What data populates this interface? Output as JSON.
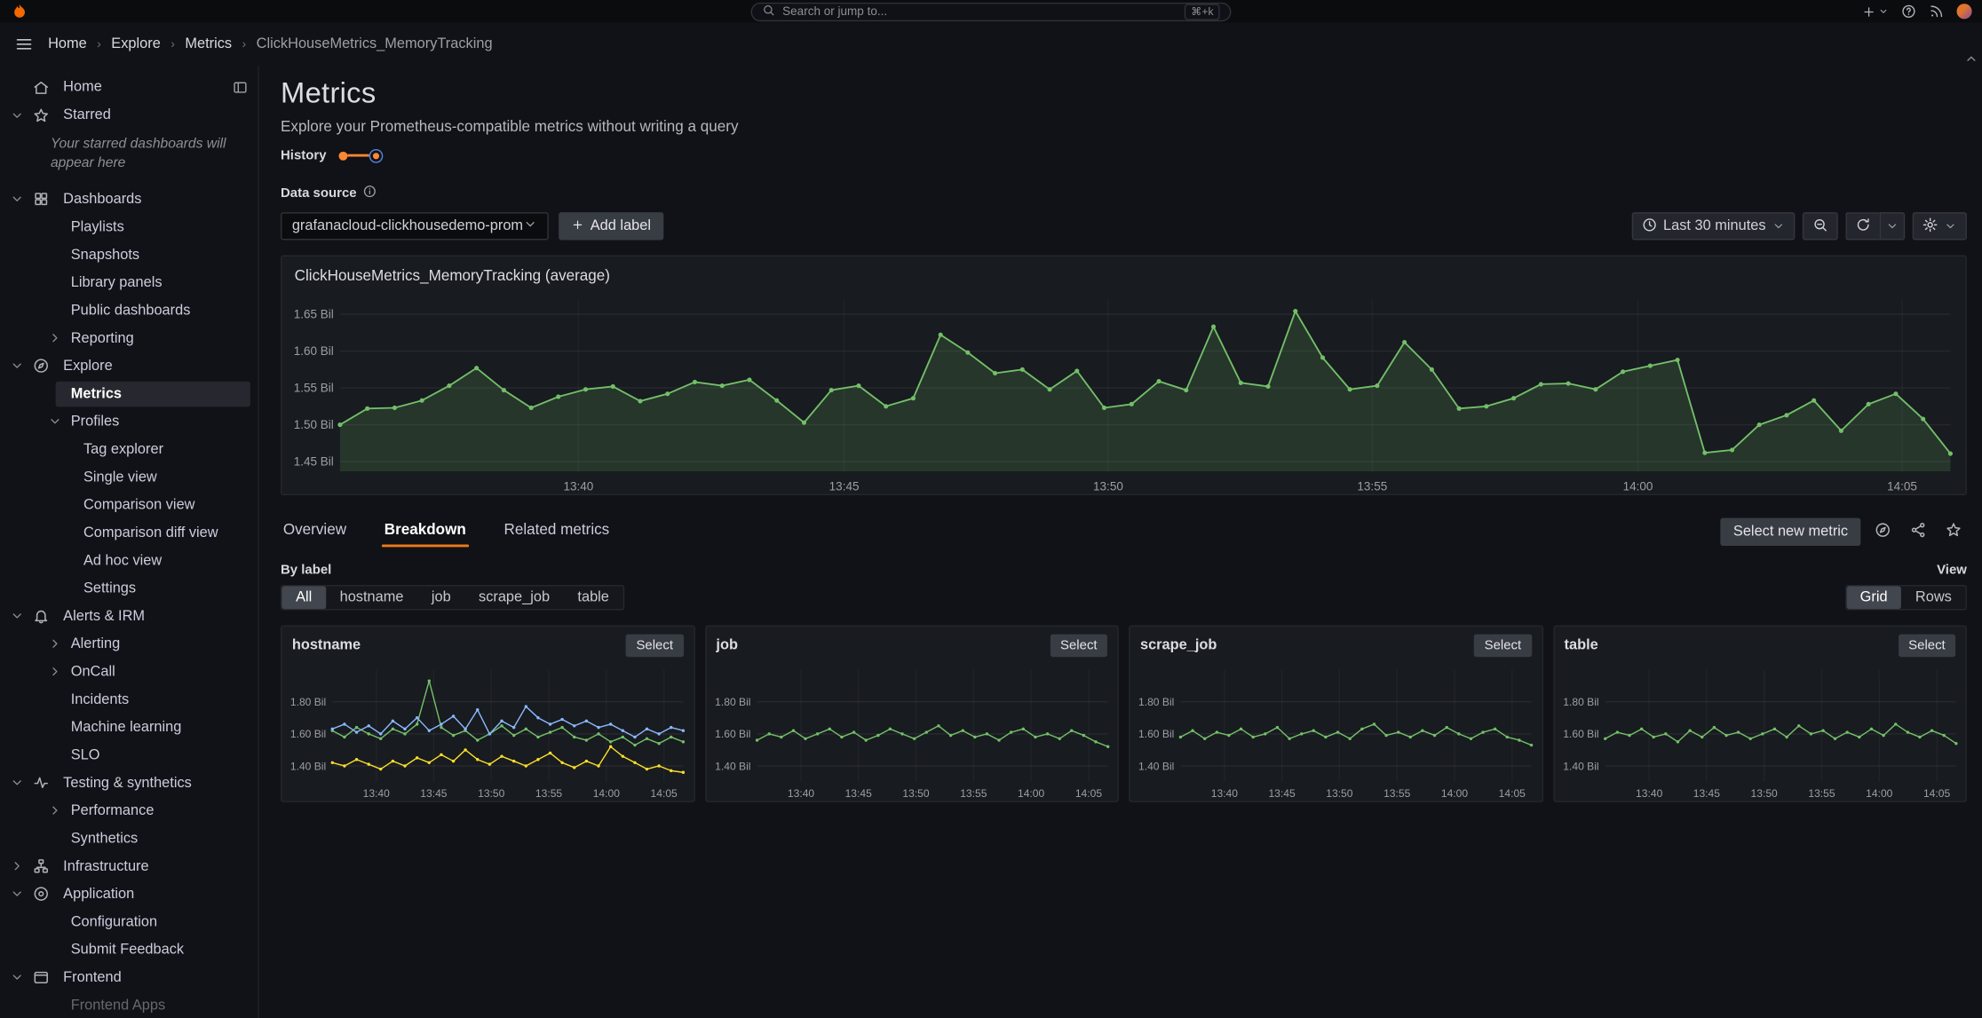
{
  "topbar": {
    "search_placeholder": "Search or jump to...",
    "search_shortcut": "⌘+k",
    "right_icons": [
      "plus",
      "help",
      "news",
      "avatar"
    ]
  },
  "breadcrumbs": [
    {
      "label": "Home"
    },
    {
      "label": "Explore"
    },
    {
      "label": "Metrics"
    },
    {
      "label": "ClickHouseMetrics_MemoryTracking"
    }
  ],
  "sidebar": {
    "items": [
      {
        "label": "Home",
        "level": 0,
        "icon": "home",
        "chevron": null,
        "dock_icon": true
      },
      {
        "label": "Starred",
        "level": 0,
        "icon": "star",
        "chevron": "down"
      },
      {
        "label": "Your starred dashboards will appear here",
        "type": "note"
      },
      {
        "label": "Dashboards",
        "level": 0,
        "icon": "apps",
        "chevron": "down"
      },
      {
        "label": "Playlists",
        "level": 1
      },
      {
        "label": "Snapshots",
        "level": 1
      },
      {
        "label": "Library panels",
        "level": 1
      },
      {
        "label": "Public dashboards",
        "level": 1
      },
      {
        "label": "Reporting",
        "level": 1,
        "chevron": "right"
      },
      {
        "label": "Explore",
        "level": 0,
        "icon": "compass",
        "chevron": "down"
      },
      {
        "label": "Metrics",
        "level": 1,
        "selected": true
      },
      {
        "label": "Profiles",
        "level": 1,
        "chevron": "down"
      },
      {
        "label": "Tag explorer",
        "level": 2
      },
      {
        "label": "Single view",
        "level": 2
      },
      {
        "label": "Comparison view",
        "level": 2
      },
      {
        "label": "Comparison diff view",
        "level": 2
      },
      {
        "label": "Ad hoc view",
        "level": 2
      },
      {
        "label": "Settings",
        "level": 2
      },
      {
        "label": "Alerts & IRM",
        "level": 0,
        "icon": "bell",
        "chevron": "down"
      },
      {
        "label": "Alerting",
        "level": 1,
        "chevron": "right"
      },
      {
        "label": "OnCall",
        "level": 1,
        "chevron": "right"
      },
      {
        "label": "Incidents",
        "level": 1
      },
      {
        "label": "Machine learning",
        "level": 1
      },
      {
        "label": "SLO",
        "level": 1
      },
      {
        "label": "Testing & synthetics",
        "level": 0,
        "icon": "pulse",
        "chevron": "down"
      },
      {
        "label": "Performance",
        "level": 1,
        "chevron": "right"
      },
      {
        "label": "Synthetics",
        "level": 1
      },
      {
        "label": "Infrastructure",
        "level": 0,
        "icon": "sitemap",
        "chevron": "right"
      },
      {
        "label": "Application",
        "level": 0,
        "icon": "bullseye",
        "chevron": "down"
      },
      {
        "label": "Configuration",
        "level": 1
      },
      {
        "label": "Submit Feedback",
        "level": 1
      },
      {
        "label": "Frontend",
        "level": 0,
        "icon": "browser",
        "chevron": "down"
      },
      {
        "label": "Frontend Apps",
        "level": 1,
        "faded": true
      }
    ]
  },
  "main": {
    "title": "Metrics",
    "subtitle": "Explore your Prometheus-compatible metrics without writing a query",
    "history_label": "History",
    "datasource_label": "Data source",
    "datasource_value": "grafanacloud-clickhousedemo-prom",
    "add_label_button": "Add label",
    "time_range_label": "Last 30 minutes",
    "tabs": [
      {
        "label": "Overview",
        "active": false
      },
      {
        "label": "Breakdown",
        "active": true
      },
      {
        "label": "Related metrics",
        "active": false
      }
    ],
    "select_new_metric_button": "Select new metric",
    "select_button_label": "Select",
    "by_label": "By label",
    "label_filters": [
      {
        "label": "All",
        "selected": true
      },
      {
        "label": "hostname",
        "selected": false
      },
      {
        "label": "job",
        "selected": false
      },
      {
        "label": "scrape_job",
        "selected": false
      },
      {
        "label": "table",
        "selected": false
      }
    ],
    "view_label": "View",
    "view_options": [
      {
        "label": "Grid",
        "selected": true
      },
      {
        "label": "Rows",
        "selected": false
      }
    ]
  },
  "colors": {
    "accent_orange": "#eb7b18",
    "series_green": "#73bf69",
    "series_yellow": "#fade2a",
    "series_blue": "#8ab8ff",
    "panel_bg": "#181b1f",
    "page_bg": "#111217"
  },
  "chart_data": [
    {
      "id": "main",
      "type": "area",
      "title": "ClickHouseMetrics_MemoryTracking (average)",
      "ylabel": "",
      "xlabel": "",
      "ylim": [
        1.437,
        1.67
      ],
      "yticks": [
        {
          "v": 1.45,
          "label": "1.45 Bil"
        },
        {
          "v": 1.5,
          "label": "1.50 Bil"
        },
        {
          "v": 1.55,
          "label": "1.55 Bil"
        },
        {
          "v": 1.6,
          "label": "1.60 Bil"
        },
        {
          "v": 1.65,
          "label": "1.65 Bil"
        }
      ],
      "xticks": [
        {
          "f": 0.148,
          "label": "13:40"
        },
        {
          "f": 0.313,
          "label": "13:45"
        },
        {
          "f": 0.477,
          "label": "13:50"
        },
        {
          "f": 0.641,
          "label": "13:55"
        },
        {
          "f": 0.806,
          "label": "14:00"
        },
        {
          "f": 0.97,
          "label": "14:05"
        }
      ],
      "series": [
        {
          "name": "average",
          "color": "#73bf69",
          "fill": true,
          "values": [
            1.5,
            1.522,
            1.523,
            1.533,
            1.553,
            1.577,
            1.547,
            1.523,
            1.538,
            1.548,
            1.552,
            1.532,
            1.542,
            1.558,
            1.553,
            1.561,
            1.533,
            1.503,
            1.547,
            1.553,
            1.525,
            1.536,
            1.622,
            1.598,
            1.57,
            1.575,
            1.548,
            1.573,
            1.523,
            1.528,
            1.559,
            1.547,
            1.633,
            1.557,
            1.552,
            1.654,
            1.591,
            1.548,
            1.553,
            1.612,
            1.575,
            1.522,
            1.525,
            1.536,
            1.555,
            1.556,
            1.548,
            1.572,
            1.58,
            1.588,
            1.462,
            1.466,
            1.5,
            1.513,
            1.533,
            1.492,
            1.528,
            1.542,
            1.508,
            1.461
          ]
        }
      ]
    },
    {
      "id": "hostname",
      "type": "line",
      "title": "hostname",
      "ylim": [
        1.3,
        2.0
      ],
      "yticks": [
        {
          "v": 1.4,
          "label": "1.40 Bil"
        },
        {
          "v": 1.6,
          "label": "1.60 Bil"
        },
        {
          "v": 1.8,
          "label": "1.80 Bil"
        }
      ],
      "xticks": [
        {
          "f": 0.125,
          "label": "13:40"
        },
        {
          "f": 0.289,
          "label": "13:45"
        },
        {
          "f": 0.453,
          "label": "13:50"
        },
        {
          "f": 0.617,
          "label": "13:55"
        },
        {
          "f": 0.781,
          "label": "14:00"
        },
        {
          "f": 0.945,
          "label": "14:05"
        }
      ],
      "series": [
        {
          "name": "hostname-green",
          "color": "#73bf69",
          "fill": false,
          "values": [
            1.62,
            1.58,
            1.64,
            1.6,
            1.57,
            1.63,
            1.6,
            1.66,
            1.93,
            1.64,
            1.59,
            1.62,
            1.56,
            1.6,
            1.65,
            1.59,
            1.63,
            1.58,
            1.61,
            1.64,
            1.58,
            1.56,
            1.6,
            1.55,
            1.58,
            1.53,
            1.57,
            1.54,
            1.58,
            1.55
          ]
        },
        {
          "name": "hostname-yellow",
          "color": "#fade2a",
          "fill": false,
          "values": [
            1.42,
            1.4,
            1.44,
            1.41,
            1.38,
            1.43,
            1.4,
            1.45,
            1.42,
            1.47,
            1.43,
            1.5,
            1.44,
            1.41,
            1.46,
            1.43,
            1.4,
            1.44,
            1.48,
            1.42,
            1.39,
            1.43,
            1.4,
            1.52,
            1.46,
            1.42,
            1.38,
            1.4,
            1.37,
            1.36
          ]
        },
        {
          "name": "hostname-blue",
          "color": "#8ab8ff",
          "fill": false,
          "values": [
            1.63,
            1.66,
            1.61,
            1.65,
            1.6,
            1.68,
            1.63,
            1.7,
            1.62,
            1.66,
            1.71,
            1.63,
            1.75,
            1.6,
            1.68,
            1.64,
            1.77,
            1.7,
            1.66,
            1.69,
            1.65,
            1.68,
            1.64,
            1.66,
            1.62,
            1.58,
            1.63,
            1.6,
            1.64,
            1.62
          ]
        }
      ]
    },
    {
      "id": "job",
      "type": "line",
      "title": "job",
      "ylim": [
        1.3,
        2.0
      ],
      "yticks": [
        {
          "v": 1.4,
          "label": "1.40 Bil"
        },
        {
          "v": 1.6,
          "label": "1.60 Bil"
        },
        {
          "v": 1.8,
          "label": "1.80 Bil"
        }
      ],
      "xticks": [
        {
          "f": 0.125,
          "label": "13:40"
        },
        {
          "f": 0.289,
          "label": "13:45"
        },
        {
          "f": 0.453,
          "label": "13:50"
        },
        {
          "f": 0.617,
          "label": "13:55"
        },
        {
          "f": 0.781,
          "label": "14:00"
        },
        {
          "f": 0.945,
          "label": "14:05"
        }
      ],
      "series": [
        {
          "name": "job",
          "color": "#73bf69",
          "fill": false,
          "values": [
            1.56,
            1.6,
            1.58,
            1.62,
            1.57,
            1.6,
            1.63,
            1.58,
            1.61,
            1.56,
            1.59,
            1.63,
            1.6,
            1.57,
            1.61,
            1.65,
            1.59,
            1.62,
            1.58,
            1.6,
            1.56,
            1.61,
            1.63,
            1.58,
            1.6,
            1.57,
            1.62,
            1.59,
            1.55,
            1.52
          ]
        }
      ]
    },
    {
      "id": "scrape_job",
      "type": "line",
      "title": "scrape_job",
      "ylim": [
        1.3,
        2.0
      ],
      "yticks": [
        {
          "v": 1.4,
          "label": "1.40 Bil"
        },
        {
          "v": 1.6,
          "label": "1.60 Bil"
        },
        {
          "v": 1.8,
          "label": "1.80 Bil"
        }
      ],
      "xticks": [
        {
          "f": 0.125,
          "label": "13:40"
        },
        {
          "f": 0.289,
          "label": "13:45"
        },
        {
          "f": 0.453,
          "label": "13:50"
        },
        {
          "f": 0.617,
          "label": "13:55"
        },
        {
          "f": 0.781,
          "label": "14:00"
        },
        {
          "f": 0.945,
          "label": "14:05"
        }
      ],
      "series": [
        {
          "name": "scrape_job",
          "color": "#73bf69",
          "fill": false,
          "values": [
            1.58,
            1.62,
            1.57,
            1.61,
            1.59,
            1.63,
            1.58,
            1.6,
            1.64,
            1.57,
            1.6,
            1.62,
            1.58,
            1.61,
            1.57,
            1.63,
            1.66,
            1.59,
            1.61,
            1.58,
            1.62,
            1.59,
            1.64,
            1.6,
            1.57,
            1.61,
            1.63,
            1.58,
            1.56,
            1.53
          ]
        }
      ]
    },
    {
      "id": "table",
      "type": "line",
      "title": "table",
      "ylim": [
        1.3,
        2.0
      ],
      "yticks": [
        {
          "v": 1.4,
          "label": "1.40 Bil"
        },
        {
          "v": 1.6,
          "label": "1.60 Bil"
        },
        {
          "v": 1.8,
          "label": "1.80 Bil"
        }
      ],
      "xticks": [
        {
          "f": 0.125,
          "label": "13:40"
        },
        {
          "f": 0.289,
          "label": "13:45"
        },
        {
          "f": 0.453,
          "label": "13:50"
        },
        {
          "f": 0.617,
          "label": "13:55"
        },
        {
          "f": 0.781,
          "label": "14:00"
        },
        {
          "f": 0.945,
          "label": "14:05"
        }
      ],
      "series": [
        {
          "name": "table",
          "color": "#73bf69",
          "fill": false,
          "values": [
            1.57,
            1.61,
            1.59,
            1.63,
            1.58,
            1.6,
            1.55,
            1.62,
            1.58,
            1.64,
            1.59,
            1.61,
            1.57,
            1.6,
            1.63,
            1.58,
            1.65,
            1.6,
            1.62,
            1.57,
            1.61,
            1.58,
            1.63,
            1.59,
            1.66,
            1.61,
            1.58,
            1.62,
            1.59,
            1.54
          ]
        }
      ]
    }
  ]
}
